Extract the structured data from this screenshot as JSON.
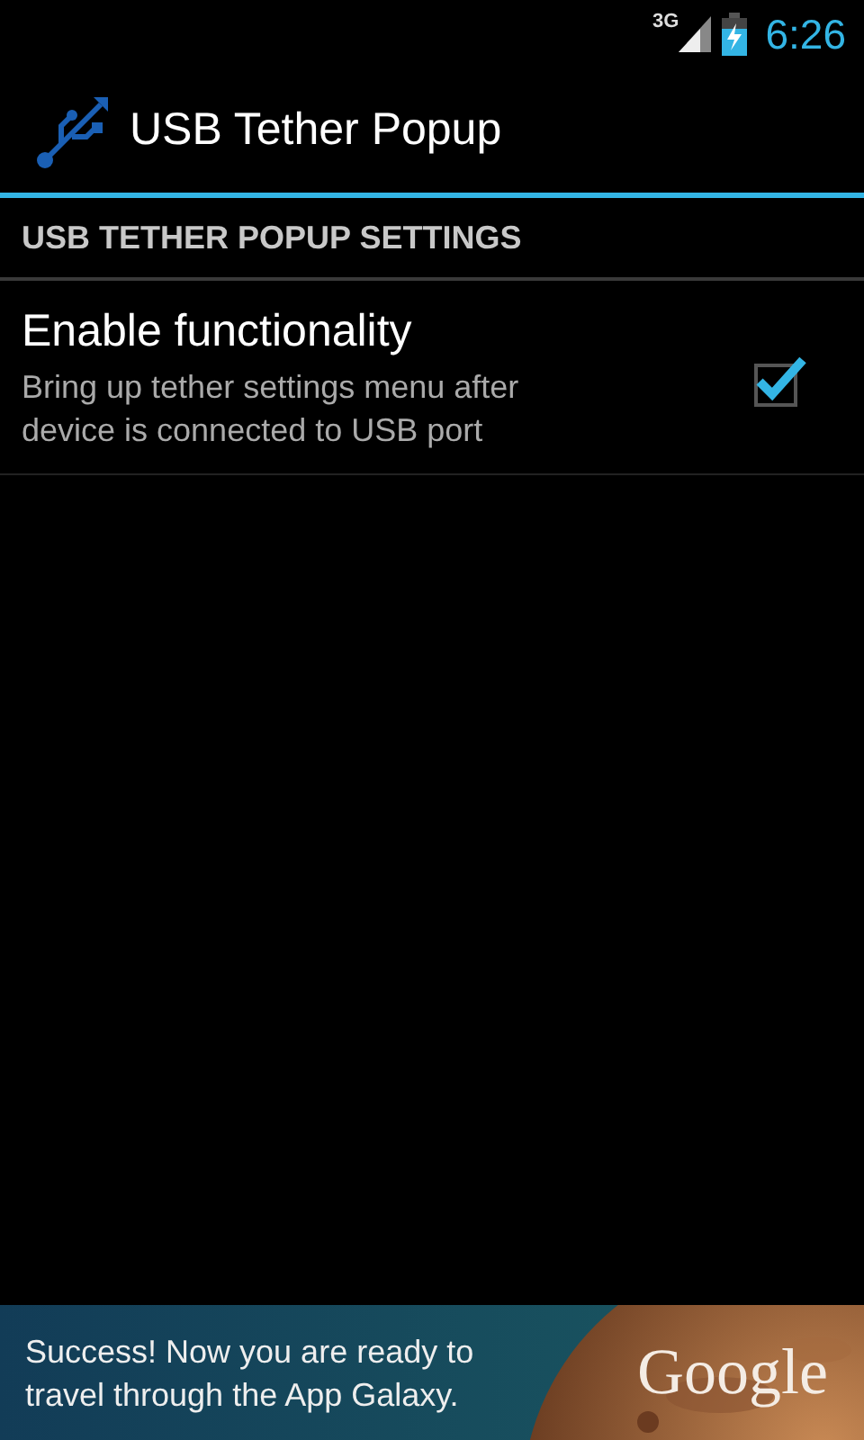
{
  "status_bar": {
    "network": "3G",
    "time": "6:26"
  },
  "action_bar": {
    "title": "USB Tether Popup"
  },
  "section": {
    "title": "USB TETHER POPUP SETTINGS"
  },
  "preferences": [
    {
      "kind": "checkbox",
      "title": "Enable functionality",
      "summary": "Bring up tether settings menu after device is connected to USB port",
      "checked": true
    }
  ],
  "ad_banner": {
    "message": "Success! Now you are ready to travel through the App Galaxy.",
    "brand": "Google"
  }
}
